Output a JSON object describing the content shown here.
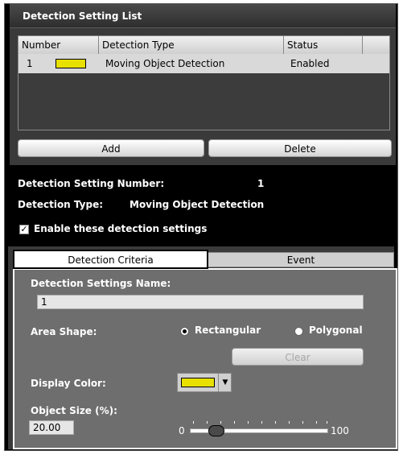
{
  "list_section": {
    "title": "Detection Setting List",
    "columns": [
      "Number",
      "Detection Type",
      "Status"
    ],
    "rows": [
      {
        "number": "1",
        "color": "#e8e000",
        "type": "Moving Object Detection",
        "status": "Enabled"
      }
    ],
    "add_label": "Add",
    "delete_label": "Delete"
  },
  "info": {
    "number_label": "Detection Setting Number:",
    "number_value": "1",
    "type_label": "Detection Type:",
    "type_value": "Moving Object Detection",
    "enable_label": "Enable these detection settings",
    "enable_checked": true
  },
  "tabs": {
    "criteria_label": "Detection Criteria",
    "event_label": "Event"
  },
  "criteria": {
    "name_label": "Detection Settings Name:",
    "name_value": "1",
    "area_label": "Area Shape:",
    "rect_label": "Rectangular",
    "poly_label": "Polygonal",
    "area_selected": "Rectangular",
    "clear_label": "Clear",
    "color_label": "Display Color:",
    "display_color": "#e8e000",
    "size_label": "Object Size (%):",
    "size_value": "20.00",
    "slider_min": "0",
    "slider_max": "100",
    "slider_level_percent": 20
  }
}
